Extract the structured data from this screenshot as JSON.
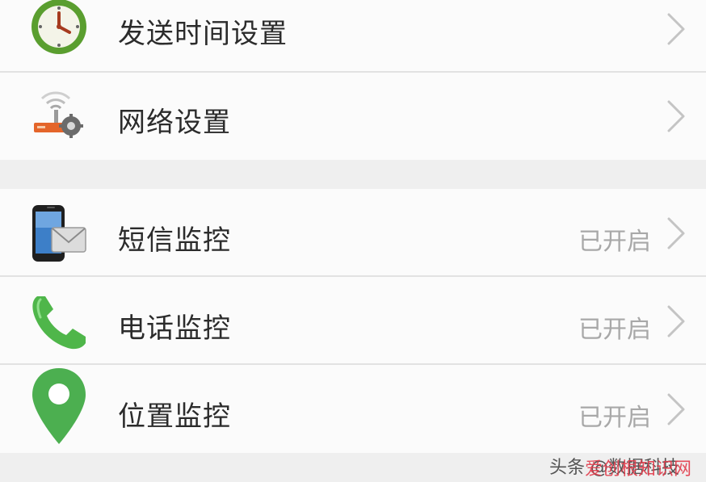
{
  "settings": {
    "rows": [
      {
        "label": "发送时间设置",
        "icon": "clock-icon"
      },
      {
        "label": "网络设置",
        "icon": "network-settings-icon"
      },
      {
        "label": "短信监控",
        "status": "已开启",
        "icon": "sms-phone-icon"
      },
      {
        "label": "电话监控",
        "status": "已开启",
        "icon": "phone-handset-icon"
      },
      {
        "label": "位置监控",
        "status": "已开启",
        "icon": "location-pin-icon"
      }
    ]
  },
  "watermark": {
    "top_text": "头条 @数据科技",
    "bottom_text": "爱创根知识网"
  },
  "colors": {
    "background": "#efefef",
    "row_background": "#fbfbfb",
    "text": "#2b2b2b",
    "status_text": "#a8a8a8",
    "icon_green": "#4caf50",
    "network_orange": "#e4652a"
  }
}
